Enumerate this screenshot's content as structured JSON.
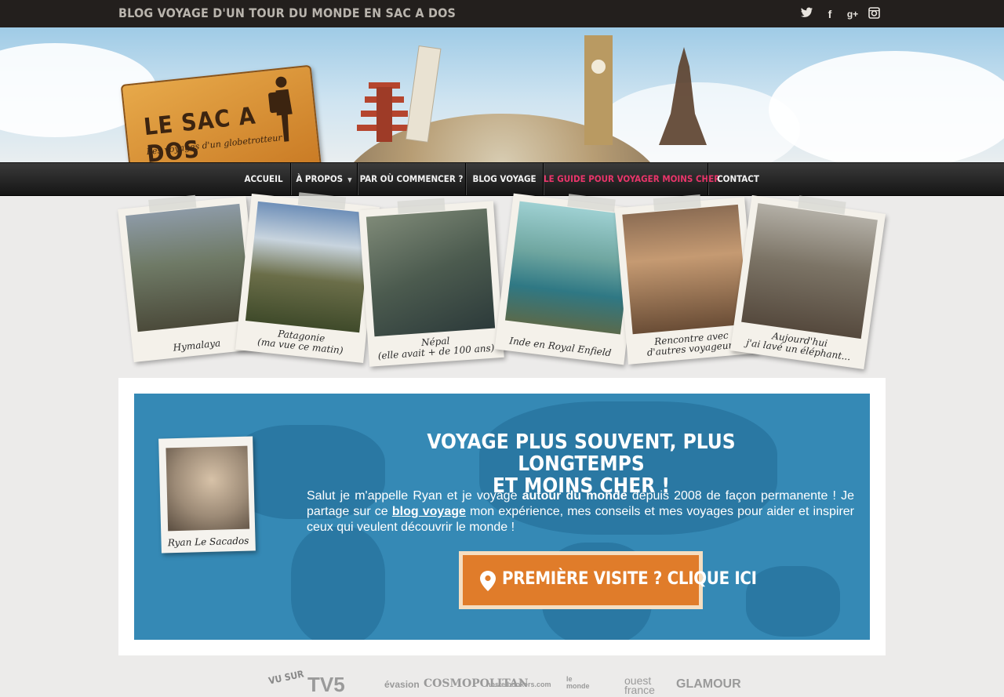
{
  "topbar": {
    "tagline": "BLOG VOYAGE D'UN TOUR DU MONDE EN SAC A DOS",
    "social": [
      {
        "name": "twitter-icon"
      },
      {
        "name": "facebook-icon",
        "glyph": "f"
      },
      {
        "name": "google-plus-icon",
        "glyph": "g+"
      },
      {
        "name": "instagram-icon"
      }
    ]
  },
  "logo": {
    "title": "LE SAC A DOS",
    "subtitle": "Les voyages d'un globetrotteur"
  },
  "nav": {
    "items": [
      {
        "label": "ACCUEIL"
      },
      {
        "label": "À PROPOS",
        "has_dropdown": true
      },
      {
        "label": "PAR OÙ COMMENCER ?"
      },
      {
        "label": "BLOG VOYAGE"
      },
      {
        "label": "LE GUIDE POUR VOYAGER MOINS CHER",
        "highlight_color": "#e8356a"
      },
      {
        "label": "CONTACT"
      }
    ]
  },
  "polaroids": [
    {
      "caption": "Hymalaya"
    },
    {
      "caption": "Patagonie\n(ma vue ce matin)"
    },
    {
      "caption": "Népal\n(elle avait + de 100 ans)"
    },
    {
      "caption": "Inde en Royal Enfield"
    },
    {
      "caption": "Rencontre avec\nd'autres voyageurs"
    },
    {
      "caption": "Aujourd'hui\nj'ai lavé un éléphant..."
    }
  ],
  "hero": {
    "title_line1": "VOYAGE PLUS SOUVENT, PLUS LONGTEMPS",
    "title_line2": "ET MOINS CHER !",
    "text_part1": "Salut je m'appelle Ryan et je voyage ",
    "text_bold": "autour du monde",
    "text_part2": " depuis 2008 de façon permanente ! Je partage sur ce ",
    "text_link": "blog voyage",
    "text_part3": " mon expérience, mes conseils et mes voyages pour aider et inspirer ceux qui veulent découvrir le monde !",
    "cta_label": "PREMIÈRE VISITE ? CLIQUE ICI",
    "avatar_caption": "Ryan Le Sacados",
    "accent": "#3589b5",
    "cta_color": "#e07c2a"
  },
  "press": {
    "label": "VU SUR",
    "logos": [
      "TV5",
      "évasion",
      "COSMOPOLITAN",
      "hostelbookers.com",
      "le monde",
      "ouest france",
      "GLAMOUR"
    ]
  }
}
